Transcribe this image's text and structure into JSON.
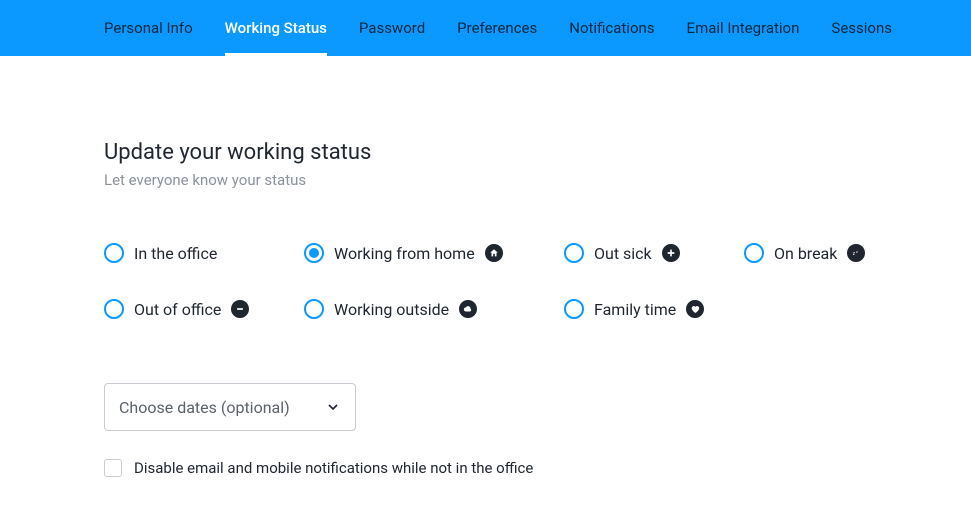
{
  "tabs": [
    {
      "label": "Personal Info",
      "active": false
    },
    {
      "label": "Working Status",
      "active": true
    },
    {
      "label": "Password",
      "active": false
    },
    {
      "label": "Preferences",
      "active": false
    },
    {
      "label": "Notifications",
      "active": false
    },
    {
      "label": "Email Integration",
      "active": false
    },
    {
      "label": "Sessions",
      "active": false
    }
  ],
  "header": {
    "title": "Update your working status",
    "subtitle": "Let everyone know your status"
  },
  "status_options": [
    {
      "label": "In the office",
      "icon": null,
      "selected": false
    },
    {
      "label": "Working from home",
      "icon": "home",
      "selected": true
    },
    {
      "label": "Out sick",
      "icon": "plus",
      "selected": false
    },
    {
      "label": "On break",
      "icon": "zzz",
      "selected": false
    },
    {
      "label": "Out of office",
      "icon": "minus",
      "selected": false
    },
    {
      "label": "Working outside",
      "icon": "cloud",
      "selected": false
    },
    {
      "label": "Family time",
      "icon": "heart",
      "selected": false
    }
  ],
  "date_selector": {
    "label": "Choose dates (optional)"
  },
  "disable_notifications": {
    "label": "Disable email and mobile notifications while not in the office",
    "checked": false
  }
}
